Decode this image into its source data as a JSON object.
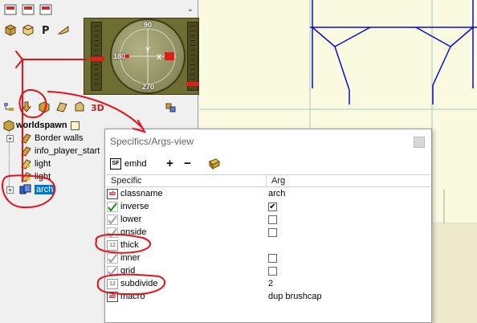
{
  "compass": {
    "label_top": "90",
    "label_left": "180",
    "label_bottom": "270",
    "axis_y": "Y",
    "axis_x": "X"
  },
  "tree": {
    "root_label": "worldspawn",
    "items": [
      {
        "label": "Border walls",
        "icon": "entity-icon",
        "expandable": true
      },
      {
        "label": "info_player_start",
        "icon": "entity-icon",
        "expandable": false
      },
      {
        "label": "light",
        "icon": "light-icon",
        "expandable": false
      },
      {
        "label": "light",
        "icon": "light-icon",
        "expandable": false
      },
      {
        "label": "arch",
        "icon": "duplicator-icon",
        "expandable": true
      }
    ]
  },
  "dialog": {
    "title": "Specifics/Args-view",
    "entity_name": "emhd",
    "sf_label": "SF",
    "add_label": "+",
    "remove_label": "−",
    "col_specific": "Specific",
    "col_arg": "Arg",
    "rows": [
      {
        "specific": "classname",
        "type": "text",
        "type_label": "ab",
        "arg": "arch"
      },
      {
        "specific": "inverse",
        "type": "flag-checked",
        "type_label": "",
        "arg": "",
        "checked": true
      },
      {
        "specific": "lower",
        "type": "flag",
        "type_label": "",
        "arg": "",
        "checked": false
      },
      {
        "specific": "onside",
        "type": "flag",
        "type_label": "",
        "arg": "",
        "checked": false
      },
      {
        "specific": "thick",
        "type": "num",
        "type_label": "12",
        "arg": ""
      },
      {
        "specific": "inner",
        "type": "flag",
        "type_label": "",
        "arg": "",
        "checked": false
      },
      {
        "specific": "grid",
        "type": "flag",
        "type_label": "",
        "arg": "",
        "checked": false
      },
      {
        "specific": "subdivide",
        "type": "num",
        "type_label": "12",
        "arg": "2"
      },
      {
        "specific": "macro",
        "type": "text",
        "type_label": "ab",
        "arg": "dup brushcap"
      }
    ]
  },
  "colors": {
    "canvas_bg": "#fafae0",
    "canvas_line": "#0b0bd0",
    "selection": "#0078d7",
    "annotation": "#e8101a",
    "compass_body": "#6e6e32"
  }
}
